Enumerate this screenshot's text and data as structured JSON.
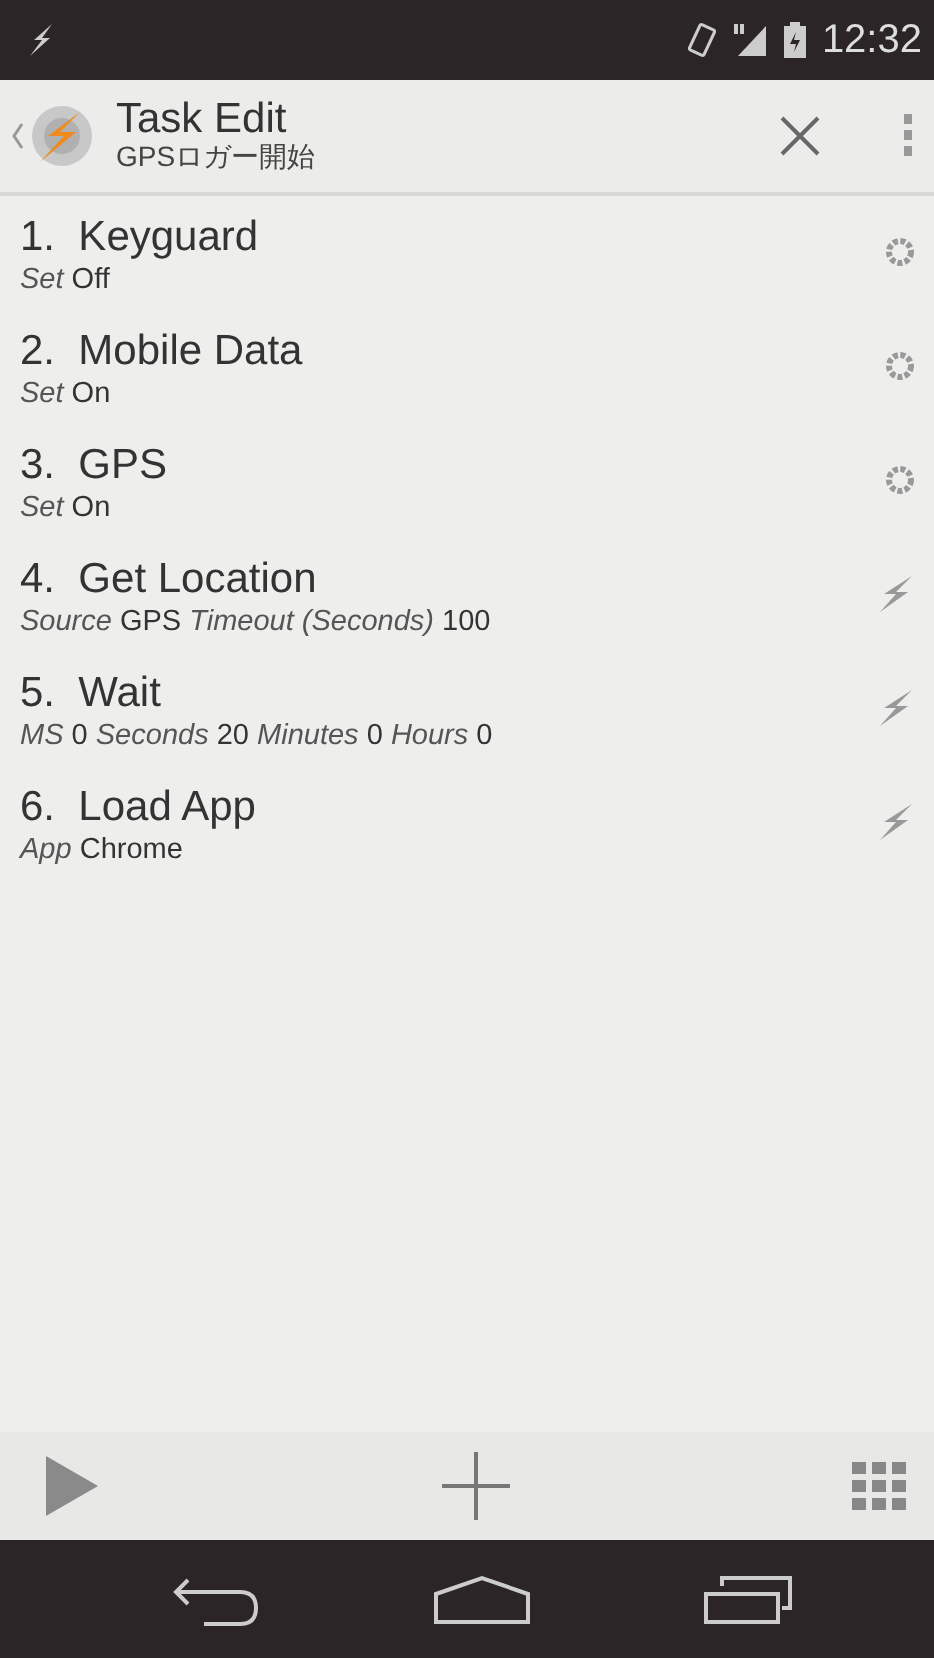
{
  "status_bar": {
    "time": "12:32"
  },
  "action_bar": {
    "title": "Task Edit",
    "subtitle": "GPSロガー開始"
  },
  "actions": [
    {
      "number": "1.",
      "name": "Keyguard",
      "kind": "setting",
      "params": [
        {
          "label": "Set",
          "value": "Off"
        }
      ]
    },
    {
      "number": "2.",
      "name": "Mobile Data",
      "kind": "setting",
      "params": [
        {
          "label": "Set",
          "value": "On"
        }
      ]
    },
    {
      "number": "3.",
      "name": "GPS",
      "kind": "setting",
      "params": [
        {
          "label": "Set",
          "value": "On"
        }
      ]
    },
    {
      "number": "4.",
      "name": "Get Location",
      "kind": "plugin",
      "params": [
        {
          "label": "Source",
          "value": "GPS"
        },
        {
          "label": "Timeout (Seconds)",
          "value": "100"
        }
      ]
    },
    {
      "number": "5.",
      "name": "Wait",
      "kind": "plugin",
      "params": [
        {
          "label": "MS",
          "value": "0"
        },
        {
          "label": "Seconds",
          "value": "20"
        },
        {
          "label": "Minutes",
          "value": "0"
        },
        {
          "label": "Hours",
          "value": "0"
        }
      ]
    },
    {
      "number": "6.",
      "name": "Load App",
      "kind": "plugin",
      "params": [
        {
          "label": "App",
          "value": "Chrome"
        }
      ]
    }
  ]
}
